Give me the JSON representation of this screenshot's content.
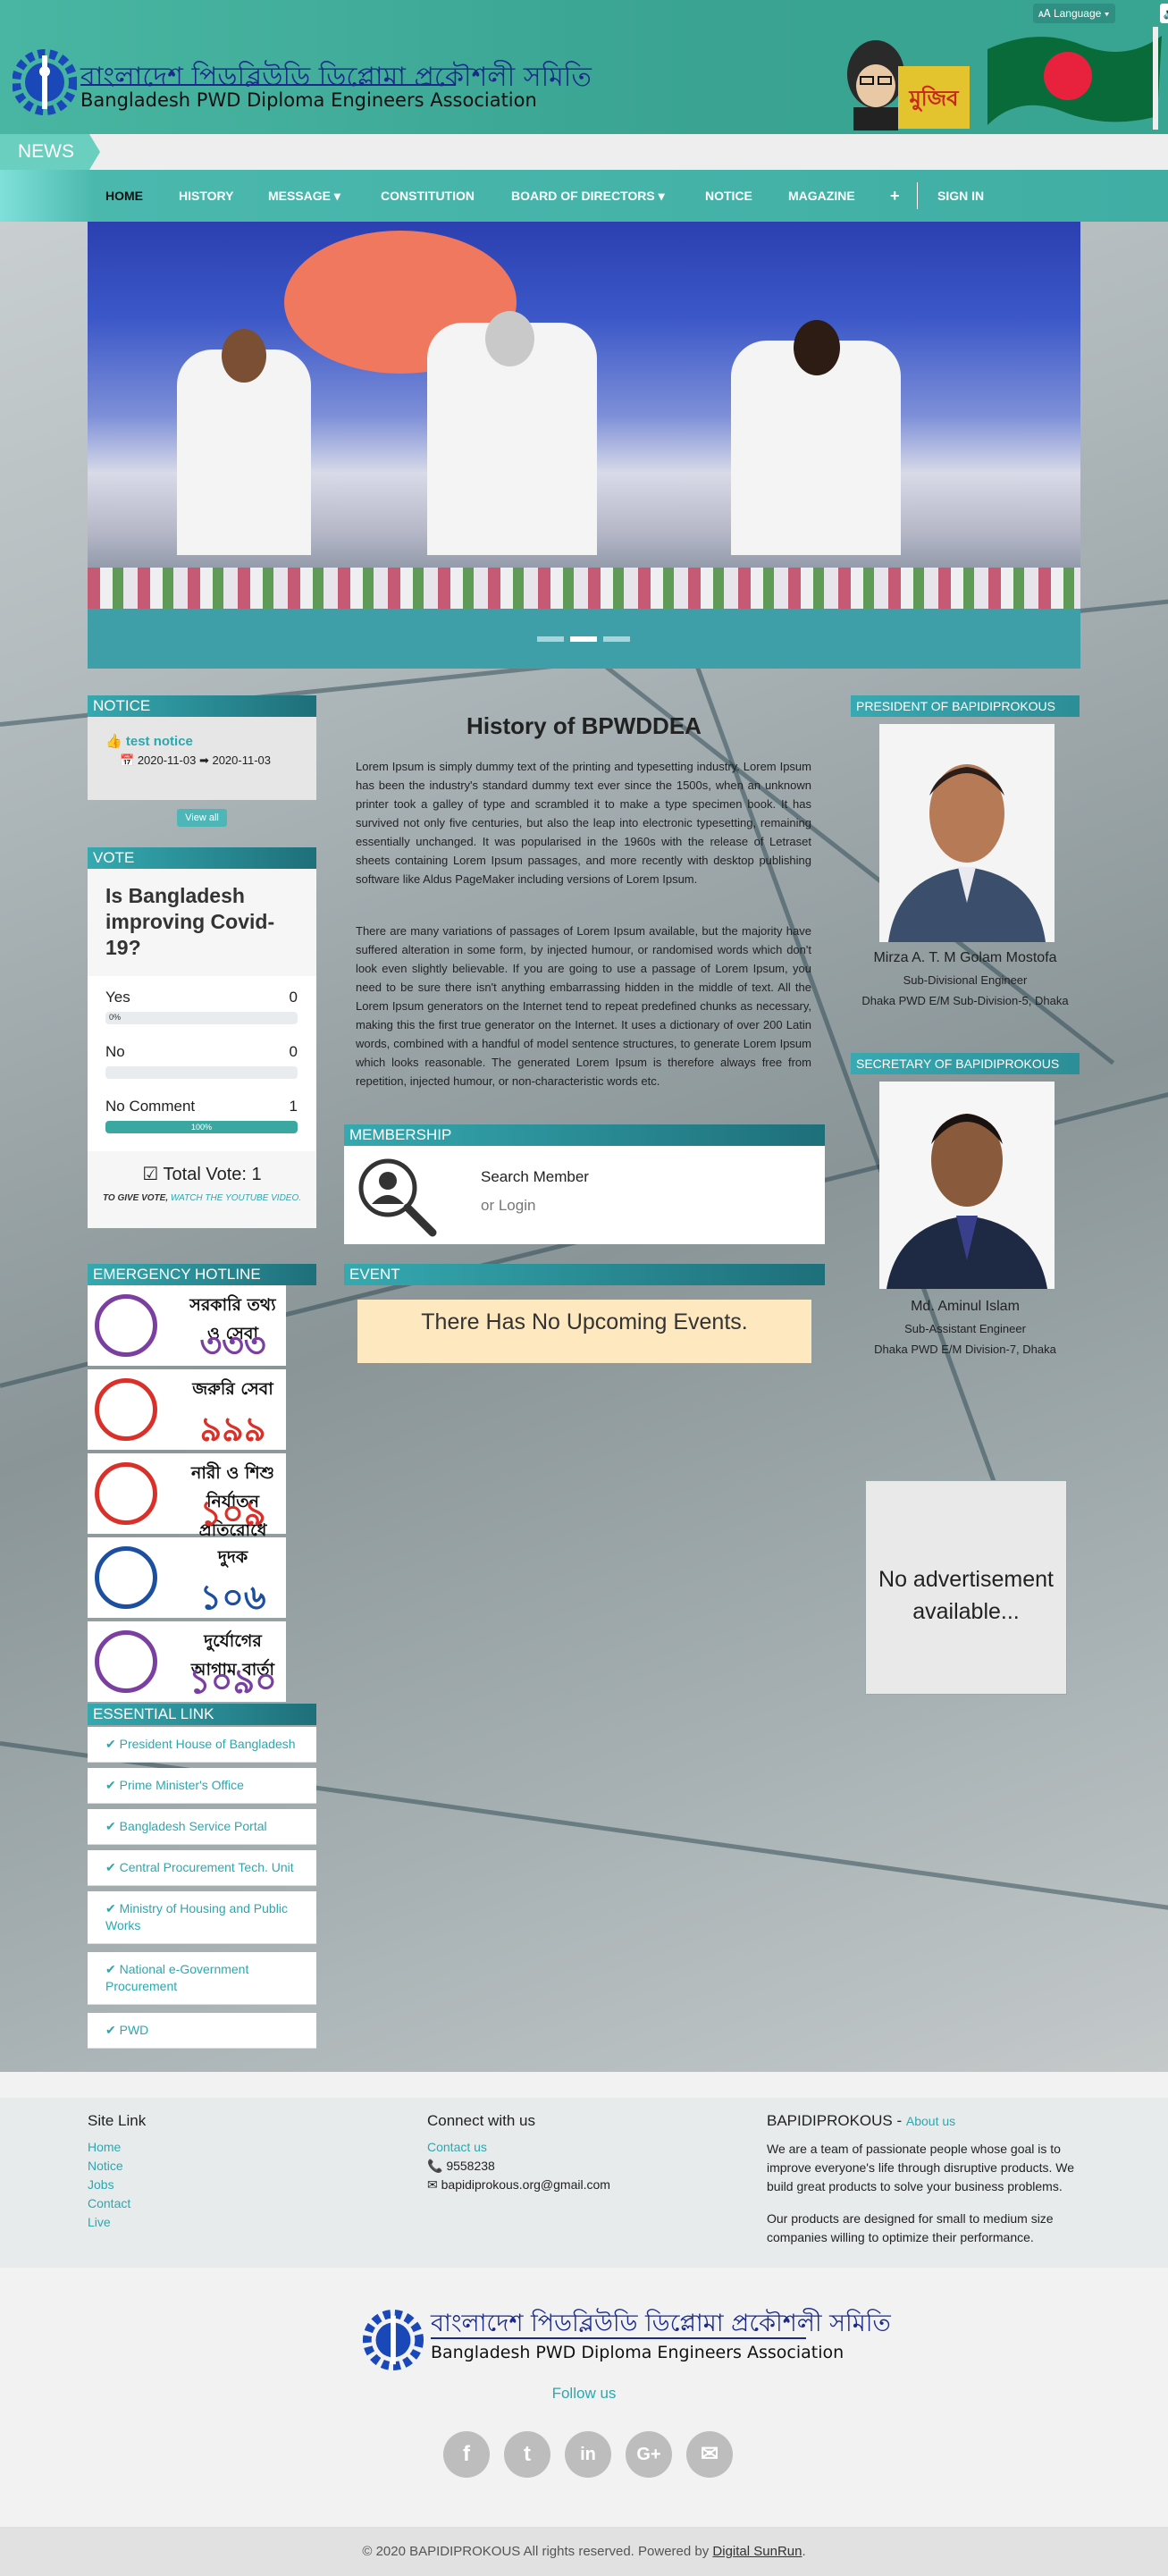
{
  "header": {
    "title_bn": "বাংলাদেশ পিডব্লিউডি ডিপ্লোমা প্রকৌশলী সমিতি",
    "title_en": "Bangladesh PWD Diploma Engineers Association",
    "language_label": "Language",
    "speaker_icon": "speaker-icon"
  },
  "news": {
    "label": "NEWS"
  },
  "nav": {
    "items": [
      {
        "label": "HOME"
      },
      {
        "label": "HISTORY"
      },
      {
        "label": "MESSAGE"
      },
      {
        "label": "CONSTITUTION"
      },
      {
        "label": "BOARD OF DIRECTORS"
      },
      {
        "label": "NOTICE"
      },
      {
        "label": "MAGAZINE"
      },
      {
        "label": "+"
      },
      {
        "label": "SIGN IN"
      }
    ]
  },
  "notice": {
    "title": "NOTICE",
    "item_title": "test notice",
    "date_range": "2020-11-03 ➡ 2020-11-03",
    "view_all": "View all"
  },
  "vote": {
    "title": "VOTE",
    "question": "Is Bangladesh improving Covid-19?",
    "options": [
      {
        "label": "Yes",
        "count": "0",
        "percent": 0,
        "pct_label": "0%"
      },
      {
        "label": "No",
        "count": "0",
        "percent": 0,
        "pct_label": ""
      },
      {
        "label": "No Comment",
        "count": "1",
        "percent": 100,
        "pct_label": "100%"
      }
    ],
    "total": "Total Vote: 1",
    "note_prefix": "TO GIVE VOTE,",
    "note_link": "WATCH THE YOUTUBE VIDEO."
  },
  "emergency": {
    "title": "EMERGENCY HOTLINE",
    "items": [
      {
        "text": "সরকারি তথ্য ও সেবা",
        "number": "৩৩৩",
        "color": "#7a3fa0"
      },
      {
        "text": "জরুরি সেবা",
        "number": "৯৯৯",
        "color": "#d9312a"
      },
      {
        "text": "নারী ও শিশু নির্যাতন প্রতিরোধে",
        "number": "১০৯",
        "color": "#d9312a"
      },
      {
        "text": "দুদক",
        "number": "১০৬",
        "color": "#1d4fa0"
      },
      {
        "text": "দুর্যোগের আগাম বার্তা",
        "number": "১০৯০",
        "color": "#7a3fa0"
      }
    ]
  },
  "essential": {
    "title": "ESSENTIAL LINK",
    "items": [
      "President House of Bangladesh",
      "Prime Minister's Office",
      "Bangladesh Service Portal",
      "Central Procurement Tech. Unit",
      "Ministry of Housing and Public Works",
      "National e-Government Procurement",
      "PWD"
    ]
  },
  "history": {
    "title": "History of BPWDDEA",
    "p1": "Lorem Ipsum is simply dummy text of the printing and typesetting industry. Lorem Ipsum has been the industry's standard dummy text ever since the 1500s, when an unknown printer took a galley of type and scrambled it to make a type specimen book. It has survived not only five centuries, but also the leap into electronic typesetting, remaining essentially unchanged. It was popularised in the 1960s with the release of Letraset sheets containing Lorem Ipsum passages, and more recently with desktop publishing software like Aldus PageMaker including versions of Lorem Ipsum.",
    "p2": "There are many variations of passages of Lorem Ipsum available, but the majority have suffered alteration in some form, by injected humour, or randomised words which don't look even slightly believable. If you are going to use a passage of Lorem Ipsum, you need to be sure there isn't anything embarrassing hidden in the middle of text. All the Lorem Ipsum generators on the Internet tend to repeat predefined chunks as necessary, making this the first true generator on the Internet. It uses a dictionary of over 200 Latin words, combined with a handful of model sentence structures, to generate Lorem Ipsum which looks reasonable. The generated Lorem Ipsum is therefore always free from repetition, injected humour, or non-characteristic words etc."
  },
  "membership": {
    "title": "MEMBERSHIP",
    "search": "Search Member",
    "login": "or Login"
  },
  "event": {
    "title": "EVENT",
    "empty": "There Has No Upcoming Events."
  },
  "president": {
    "title": "PRESIDENT OF BAPIDIPROKOUS",
    "name": "Mirza A. T. M Golam Mostofa",
    "designation": "Sub-Divisional Engineer",
    "office": "Dhaka PWD E/M Sub-Division-5, Dhaka"
  },
  "secretary": {
    "title": "SECRETARY OF BAPIDIPROKOUS",
    "name": "Md. Aminul Islam",
    "designation": "Sub-Assistant Engineer",
    "office": "Dhaka PWD E/M Division-7, Dhaka"
  },
  "ad": {
    "text": "No advertisement available..."
  },
  "footer": {
    "site_link_title": "Site Link",
    "site_links": [
      "Home",
      "Notice",
      "Jobs",
      "Contact",
      "Live"
    ],
    "connect_title": "Connect with us",
    "contact_link": "Contact us",
    "phone": "9558238",
    "email": "bapidiprokous.org@gmail.com",
    "about_title": "BAPIDIPROKOUS -",
    "about_link": "About us",
    "about_p1": "We are a team of passionate people whose goal is to improve everyone's life through disruptive products. We build great products to solve your business problems.",
    "about_p2": "Our products are designed for small to medium size companies willing to optimize their performance.",
    "follow": "Follow us",
    "social": [
      {
        "icon": "facebook-icon",
        "glyph": "f"
      },
      {
        "icon": "twitter-icon",
        "glyph": "t"
      },
      {
        "icon": "linkedin-icon",
        "glyph": "in"
      },
      {
        "icon": "google-plus-icon",
        "glyph": "G+"
      },
      {
        "icon": "mail-icon",
        "glyph": "✉"
      }
    ],
    "copyright": "© 2020 BAPIDIPROKOUS All rights reserved. Powered by",
    "powered_by": "Digital SunRun",
    "period": "."
  },
  "colors": {
    "brand": "#3aa392",
    "accent": "#2aa8b0",
    "panel_head": "#2c8e97"
  }
}
